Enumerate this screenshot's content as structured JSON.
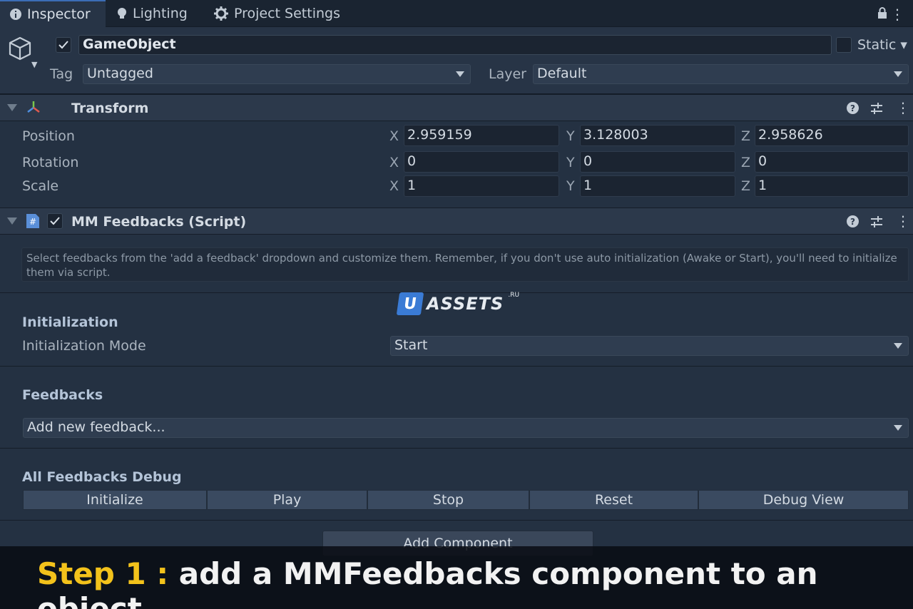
{
  "tabs": [
    {
      "label": "Inspector",
      "icon": "info-icon"
    },
    {
      "label": "Lighting",
      "icon": "bulb-icon"
    },
    {
      "label": "Project Settings",
      "icon": "gear-icon"
    }
  ],
  "header": {
    "object_name": "GameObject",
    "static_label": "Static",
    "tag_label": "Tag",
    "tag_value": "Untagged",
    "layer_label": "Layer",
    "layer_value": "Default"
  },
  "transform": {
    "title": "Transform",
    "rows": [
      {
        "label": "Position",
        "x": "2.959159",
        "y": "3.128003",
        "z": "2.958626"
      },
      {
        "label": "Rotation",
        "x": "0",
        "y": "0",
        "z": "0"
      },
      {
        "label": "Scale",
        "x": "1",
        "y": "1",
        "z": "1"
      }
    ],
    "axes": {
      "x": "X",
      "y": "Y",
      "z": "Z"
    }
  },
  "script": {
    "title": "MM Feedbacks (Script)",
    "help_text": "Select feedbacks from the 'add a feedback' dropdown and customize them. Remember, if you don't use auto initialization (Awake or Start), you'll need to initialize them via script.",
    "init_title": "Initialization",
    "init_mode_label": "Initialization Mode",
    "init_mode_value": "Start",
    "feedbacks_title": "Feedbacks",
    "add_feedback_value": "Add new feedback...",
    "debug_title": "All Feedbacks Debug",
    "buttons": [
      "Initialize",
      "Play",
      "Stop",
      "Reset",
      "Debug View"
    ]
  },
  "add_component": "Add Component",
  "watermark": {
    "letter": "U",
    "text": "ASSETS",
    "suffix": ".RU"
  },
  "caption": {
    "step": "Step 1 :",
    "text": "add a MMFeedbacks component to an object"
  },
  "colors": {
    "accent": "#3b6db6",
    "caption_step": "#f3c21b"
  }
}
